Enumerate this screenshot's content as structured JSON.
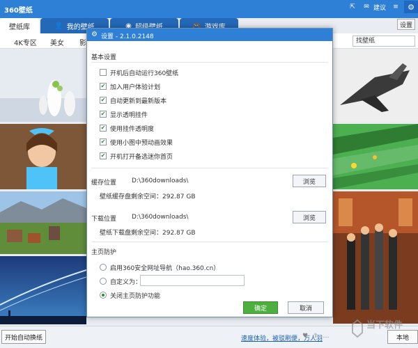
{
  "titlebar": {
    "title": "360壁纸",
    "feedback_label": "建议"
  },
  "tabs": [
    {
      "label": "壁纸库",
      "icon": "",
      "active": true
    },
    {
      "label": "我的壁纸",
      "icon": "user-icon",
      "active": false
    },
    {
      "label": "超级壁纸",
      "icon": "globe-icon",
      "active": false
    },
    {
      "label": "游戏库",
      "icon": "gamepad-icon",
      "active": false
    }
  ],
  "settings_button": "设置",
  "categories": [
    "4K专区",
    "美女",
    "影"
  ],
  "search": {
    "value": "找壁纸"
  },
  "dialog": {
    "title": "设置 - 2.1.0.2148",
    "basic_section": "基本设置",
    "checkboxes": [
      {
        "label": "开机后自动运行360壁纸",
        "checked": false
      },
      {
        "label": "加入用户体验计划",
        "checked": true
      },
      {
        "label": "自动更新到最新版本",
        "checked": true
      },
      {
        "label": "显示透明挂件",
        "checked": true
      },
      {
        "label": "使用挂件透明度",
        "checked": true
      },
      {
        "label": "使用小图中预动画效果",
        "checked": true
      },
      {
        "label": "开机打开备选迷你首页",
        "checked": true
      }
    ],
    "cache": {
      "label": "缓存位置",
      "path": "D:\\360downloads\\",
      "space": "壁纸缓存盘剩余空间：292.87 GB",
      "browse": "浏览"
    },
    "download": {
      "label": "下载位置",
      "path": "D:\\360downloads\\",
      "space": "壁纸下载盘剩余空间：292.87 GB",
      "browse": "浏览"
    },
    "home_section": "主页防护",
    "radios": [
      {
        "label": "启用360安全网址导航（hao.360.cn）",
        "on": false
      },
      {
        "label": "自定义为：",
        "on": false
      },
      {
        "label": "关闭主页防护功能",
        "on": true
      }
    ],
    "ok": "确定",
    "cancel": "取消"
  },
  "bottom": {
    "auto_change": "开始自动换纸",
    "promo": "速度体验，被驳刷便，万人羽",
    "local": "本地"
  },
  "watermark": "当下软件"
}
